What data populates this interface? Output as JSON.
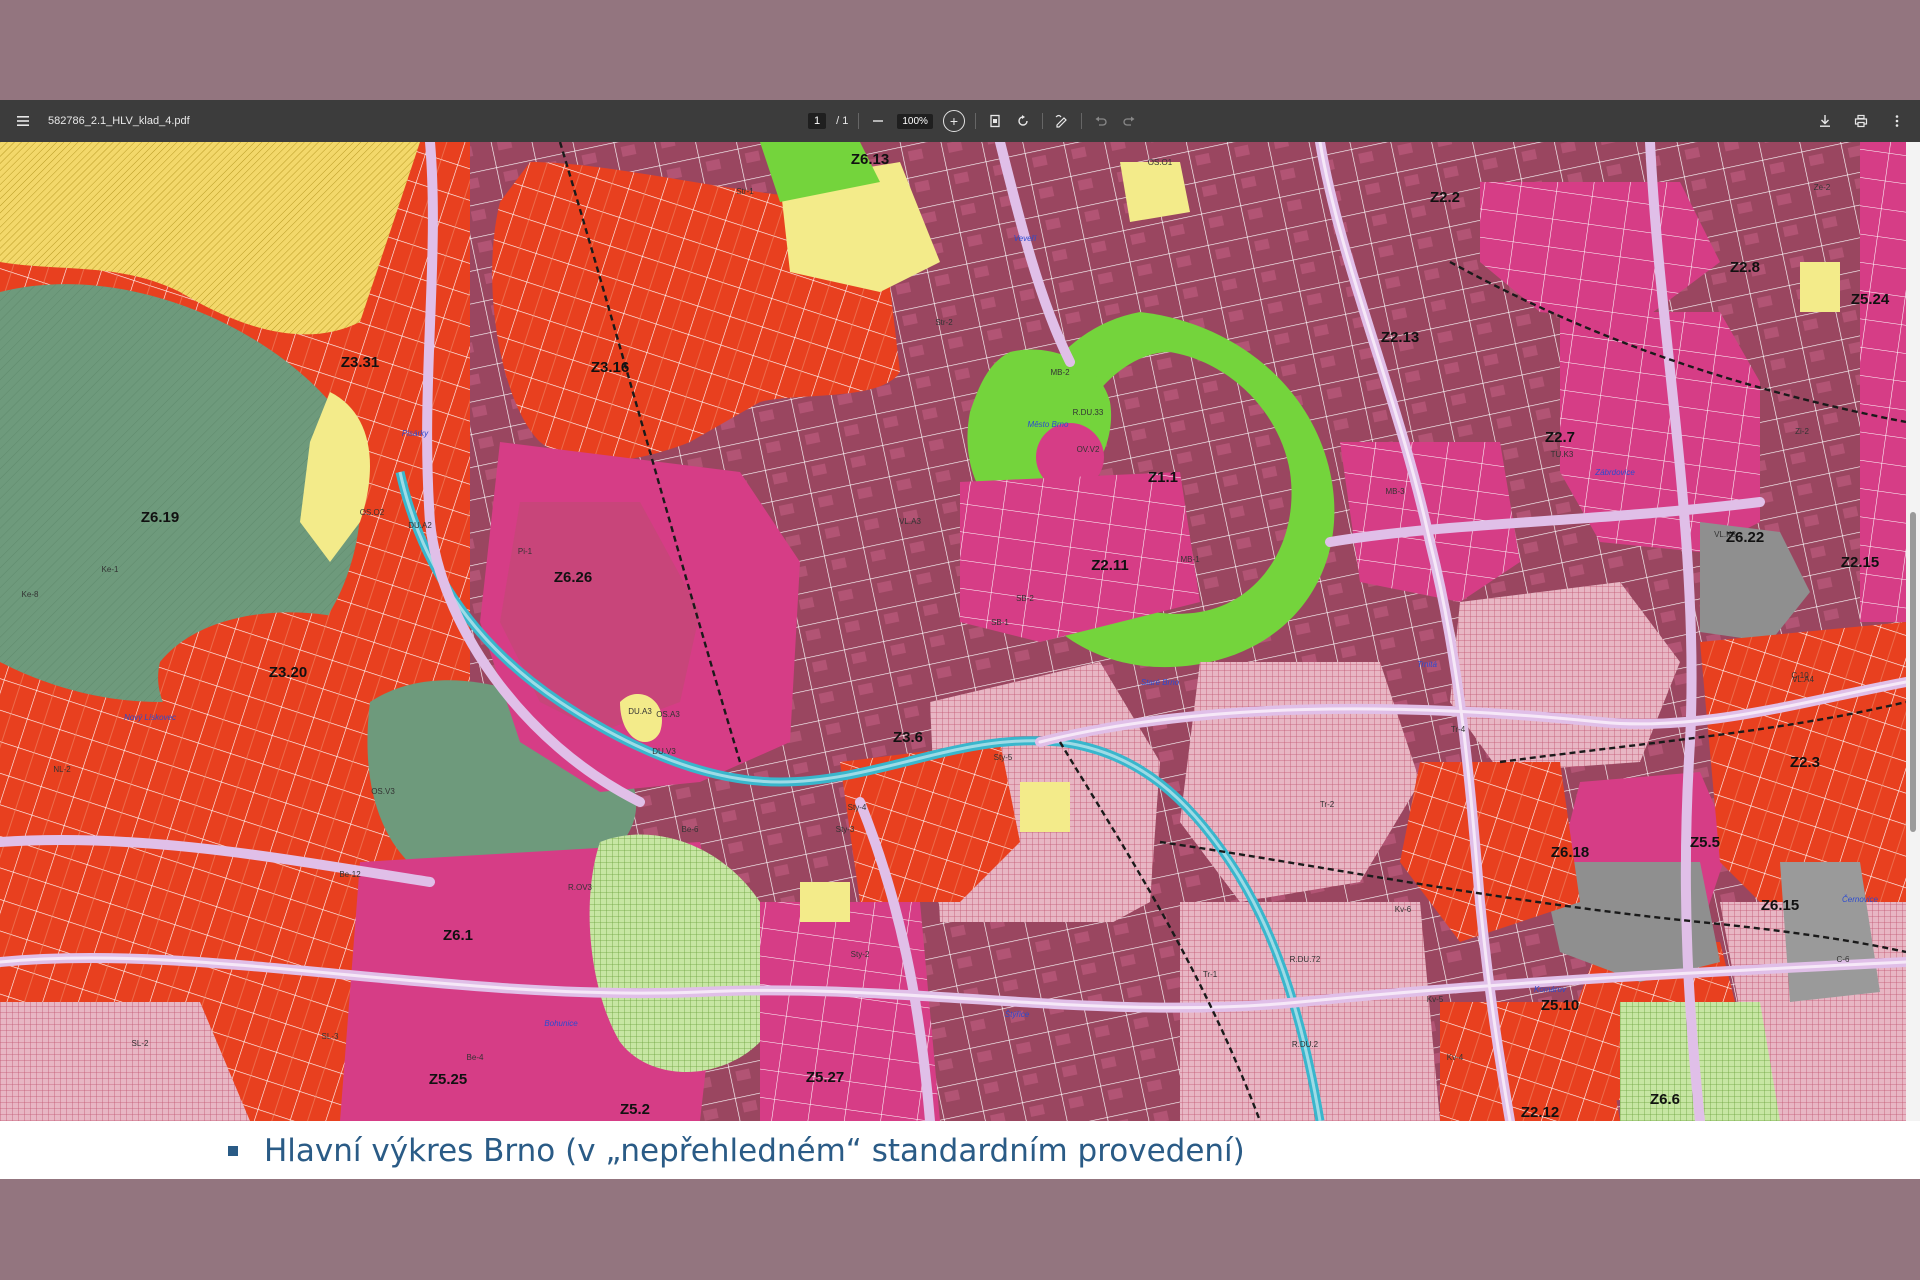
{
  "viewer": {
    "filename": "582786_2.1_HLV_klad_4.pdf",
    "page_current": "1",
    "page_total": "/ 1",
    "zoom": "100%"
  },
  "map": {
    "zone_labels": [
      "Z6.13",
      "Z2.2",
      "Z2.8",
      "Z5.24",
      "Z3.31",
      "Z3.16",
      "Z2.13",
      "Z6.19",
      "Z2.7",
      "Z1.1",
      "Z6.22",
      "Z6.26",
      "Z2.11",
      "Z2.15",
      "Z3.20",
      "Z3.6",
      "Z2.3",
      "Z6.18",
      "Z5.5",
      "Z6.15",
      "Z6.1",
      "Z5.10",
      "Z5.25",
      "Z5.27",
      "Z5.2",
      "Z6.6",
      "Z2.12"
    ],
    "place_labels": [
      "Nový Lískovec",
      "Bohunice",
      "Štýřice",
      "Staré Brno",
      "Komárov",
      "Černovice",
      "Zábrdovice",
      "Trnitá",
      "Město Brno",
      "Veveří",
      "Pisárky"
    ],
    "code_labels": [
      "R.DU.33",
      "MB-2",
      "MB-1",
      "SB-2",
      "SB-1",
      "Sty-5",
      "Sty-4",
      "Sty-3",
      "Sty-2",
      "Tr-1",
      "Tr-2",
      "Tr-4",
      "Kv-6",
      "Kv-5",
      "Kv-4",
      "R.OV3",
      "Be-6",
      "Be-12",
      "Be-4",
      "NL-2",
      "SL-3",
      "SL-2",
      "Ke-1",
      "Ke-8",
      "Pi-1",
      "Str-2",
      "Str-1",
      "Zi-2",
      "Ze-2",
      "R.DU.72",
      "R.DU.2",
      "C-10",
      "C-6",
      "OS.V3",
      "DU.A2",
      "DU.V3",
      "DU.A3",
      "OV.V2",
      "TU.K3",
      "VL.A3",
      "VL.K3",
      "VL.A4",
      "OS.O1",
      "OS.O2",
      "OS.A3",
      "MB-3"
    ]
  },
  "caption": {
    "text": "Hlavní výkres Brno (v „nepřehledném“ standardním provedení)"
  },
  "colors": {
    "background": "#93757f",
    "caption_text": "#2a5b86",
    "toolbar": "#3c3c3c"
  },
  "icons": [
    "menu-icon",
    "zoom-out-icon",
    "zoom-in-icon",
    "fit-page-icon",
    "rotate-icon",
    "annotate-icon",
    "undo-icon",
    "redo-icon",
    "download-icon",
    "print-icon",
    "more-icon"
  ]
}
